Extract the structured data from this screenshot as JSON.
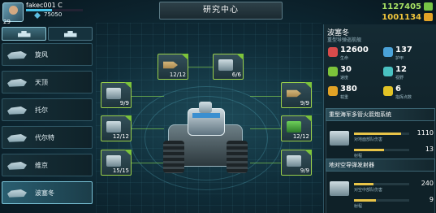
{
  "player": {
    "name": "fakec001 C",
    "level": "29",
    "power": "75050",
    "xp_progress": 0.45
  },
  "header": {
    "title": "研究中心"
  },
  "resources": [
    {
      "name": "resource-credits",
      "value": "1127405",
      "color": "#a6e063"
    },
    {
      "name": "resource-gold",
      "value": "1001134",
      "color": "#f0c53c"
    }
  ],
  "units": [
    {
      "name": "旋风",
      "active": false
    },
    {
      "name": "天顶",
      "active": false
    },
    {
      "name": "托尔",
      "active": false
    },
    {
      "name": "代尔特",
      "active": false
    },
    {
      "name": "维京",
      "active": false
    },
    {
      "name": "波塞冬",
      "active": true
    }
  ],
  "tree": [
    {
      "count": "12/12",
      "icon": "shell-icon"
    },
    {
      "count": "6/6",
      "icon": "radar-icon"
    },
    {
      "count": "9/9",
      "icon": "armor-icon"
    },
    {
      "count": "9/9",
      "icon": "missile-icon"
    },
    {
      "count": "12/12",
      "icon": "engine-icon"
    },
    {
      "count": "12/12",
      "icon": "chip-icon"
    },
    {
      "count": "15/15",
      "icon": "tank-icon"
    },
    {
      "count": "9/9",
      "icon": "artillery-icon"
    }
  ],
  "detail": {
    "unit_name": "波塞冬",
    "unit_sub": "重型导弹巡航舰",
    "stats": [
      {
        "value": "12600",
        "label": "生命",
        "color": "#d84b4b"
      },
      {
        "value": "137",
        "label": "护甲",
        "color": "#4aa2d8"
      },
      {
        "value": "30",
        "label": "速度",
        "color": "#7cc33a"
      },
      {
        "value": "12",
        "label": "视野",
        "color": "#4ac2c2"
      },
      {
        "value": "380",
        "label": "载重",
        "color": "#e2a326"
      },
      {
        "value": "6",
        "label": "指挥点数",
        "color": "#e2c326"
      }
    ],
    "weapons": [
      {
        "title": "重型海军多管火箭炮系统",
        "rows": [
          {
            "label": "对地面部队伤害",
            "value": "1110",
            "fill": 0.85
          },
          {
            "label": "射程",
            "value": "13",
            "fill": 0.55
          }
        ]
      },
      {
        "title": "地对空导弹发射器",
        "rows": [
          {
            "label": "对空中部队伤害",
            "value": "240",
            "fill": 0.35
          },
          {
            "label": "射程",
            "value": "9",
            "fill": 0.4
          }
        ]
      }
    ]
  }
}
